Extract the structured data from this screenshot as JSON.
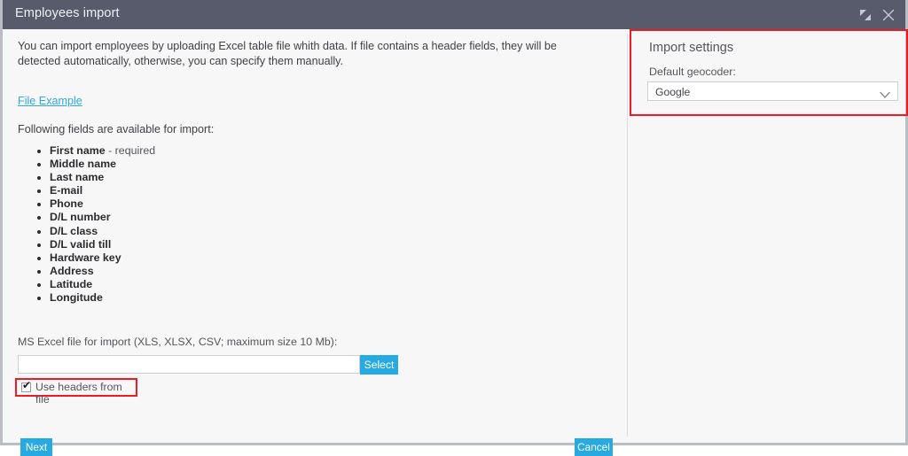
{
  "window": {
    "title": "Employees import",
    "restore_icon": "restore-arrows-icon",
    "close_icon": "close-icon"
  },
  "left": {
    "intro": "You can import employees by uploading Excel table file whith data. If file contains a header fields, they will be detected automatically, otherwise, you can specify them manually.",
    "file_example_link": "File Example",
    "fields_heading": "Following fields are available for import:",
    "fields": [
      {
        "name": "First name",
        "note": " - required"
      },
      {
        "name": "Middle name",
        "note": ""
      },
      {
        "name": "Last name",
        "note": ""
      },
      {
        "name": "E-mail",
        "note": ""
      },
      {
        "name": "Phone",
        "note": ""
      },
      {
        "name": "D/L number",
        "note": ""
      },
      {
        "name": "D/L class",
        "note": ""
      },
      {
        "name": "D/L valid till",
        "note": ""
      },
      {
        "name": "Hardware key",
        "note": ""
      },
      {
        "name": "Address",
        "note": ""
      },
      {
        "name": "Latitude",
        "note": ""
      },
      {
        "name": "Longitude",
        "note": ""
      }
    ],
    "file_label": "MS Excel file for import (XLS, XLSX, CSV; maximum size 10 Mb):",
    "file_value": "",
    "file_placeholder": "",
    "select_button": "Select",
    "use_headers_label": "Use headers from file",
    "use_headers_checked": true,
    "use_headers_check_glyph": "✔",
    "next_button": "Next",
    "cancel_button": "Cancel"
  },
  "right": {
    "panel_title": "Import settings",
    "geocoder_label": "Default geocoder:",
    "geocoder_value": "Google",
    "geocoder_options": [
      "Google"
    ],
    "chevron_icon": "chevron-down-icon"
  },
  "colors": {
    "titlebar": "#575b6b",
    "accent": "#27a9e1",
    "link": "#2fa8e0",
    "highlight": "#ed1c24",
    "background": "#f7f7f7",
    "frame": "#b9bdc6"
  }
}
